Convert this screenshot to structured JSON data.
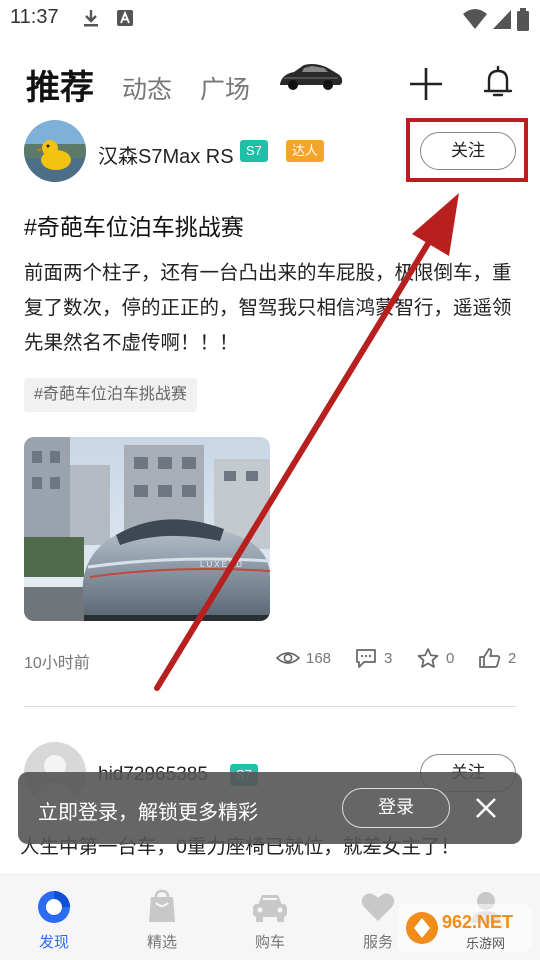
{
  "status_bar": {
    "time": "11:37",
    "icons": [
      "download-icon",
      "a-notification-icon",
      "wifi-icon",
      "signal-icon",
      "battery-icon"
    ]
  },
  "header": {
    "tabs": [
      {
        "label": "推荐",
        "active": true
      },
      {
        "label": "动态",
        "active": false
      },
      {
        "label": "广场",
        "active": false
      }
    ],
    "icons": [
      "car-tab-icon",
      "plus-icon",
      "bell-icon"
    ]
  },
  "post1": {
    "username": "汉森S7Max RS",
    "model_badge": "S7",
    "expert_badge": "达人",
    "follow_label": "关注",
    "title": "#奇葩车位泊车挑战赛",
    "body": "前面两个柱子，还有一台凸出来的车屁股，极限倒车，重复了数次，停的正正的，智驾我只相信鸿蒙智行，遥遥领先果然名不虚传啊！！！",
    "topic": "#奇葩车位泊车挑战赛",
    "image_text": "LUXEED",
    "time": "10小时前",
    "stats": {
      "views": "168",
      "comments": "3",
      "favorites": "0",
      "likes": "2"
    }
  },
  "post2": {
    "username": "hid72965385",
    "model_badge": "S7",
    "follow_label": "关注",
    "body": "人生中第一台车，0重力座椅已就位，就差女主了！"
  },
  "login_toast": {
    "text": "立即登录，解锁更多精彩",
    "button_label": "登录"
  },
  "bottom_nav": [
    {
      "label": "发现",
      "icon": "discover-icon",
      "active": true
    },
    {
      "label": "精选",
      "icon": "bag-icon",
      "active": false
    },
    {
      "label": "购车",
      "icon": "car-icon",
      "active": false
    },
    {
      "label": "服务",
      "icon": "heart-icon",
      "active": false
    },
    {
      "label": "",
      "icon": "profile-icon",
      "active": false
    }
  ],
  "watermark": {
    "text": "962.NET",
    "subtext": "乐游网"
  },
  "colors": {
    "accent": "#2c6cf3",
    "model_badge": "#1fc0a8",
    "expert_badge": "#f3a42b",
    "annotation": "#b81f1f"
  }
}
